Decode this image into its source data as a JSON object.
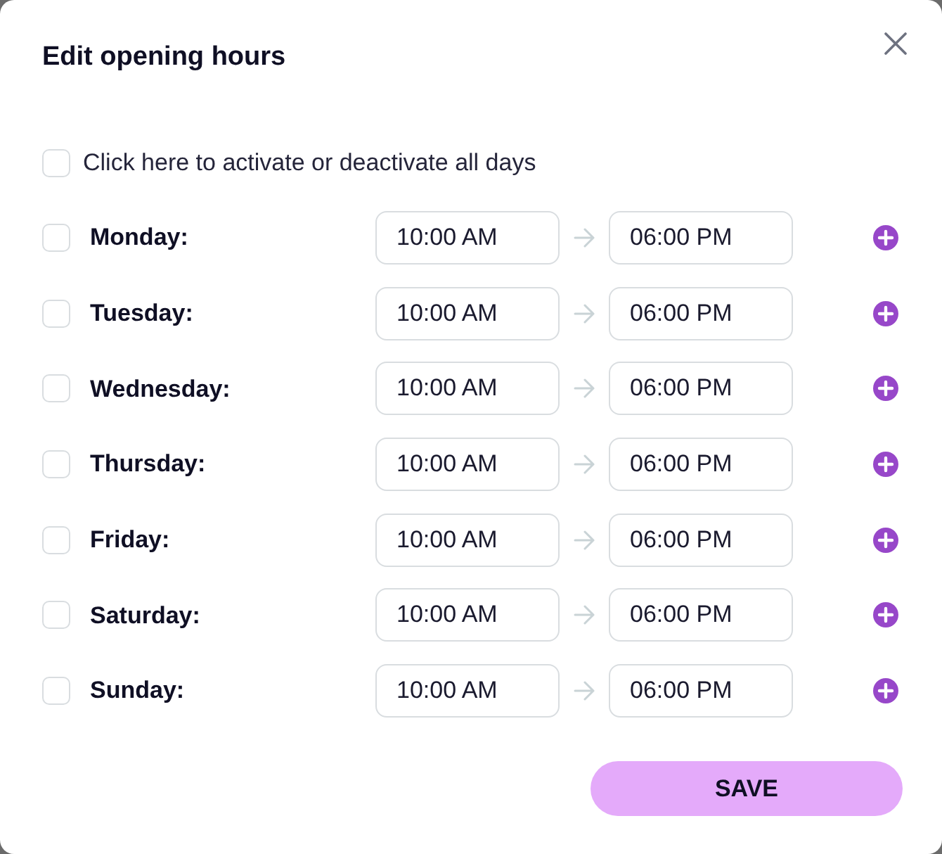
{
  "dialog": {
    "title": "Edit opening hours"
  },
  "all_days": {
    "label": "Click here to activate or deactivate all days",
    "checked": false
  },
  "days": [
    {
      "label": "Monday:",
      "checked": false,
      "from": "10:00 AM",
      "to": "06:00 PM"
    },
    {
      "label": "Tuesday:",
      "checked": false,
      "from": "10:00 AM",
      "to": "06:00 PM"
    },
    {
      "label": "Wednesday:",
      "checked": false,
      "from": "10:00 AM",
      "to": "06:00 PM"
    },
    {
      "label": "Thursday:",
      "checked": false,
      "from": "10:00 AM",
      "to": "06:00 PM"
    },
    {
      "label": "Friday:",
      "checked": false,
      "from": "10:00 AM",
      "to": "06:00 PM"
    },
    {
      "label": "Saturday:",
      "checked": false,
      "from": "10:00 AM",
      "to": "06:00 PM"
    },
    {
      "label": "Sunday:",
      "checked": false,
      "from": "10:00 AM",
      "to": "06:00 PM"
    }
  ],
  "save_button": {
    "label": "SAVE"
  }
}
